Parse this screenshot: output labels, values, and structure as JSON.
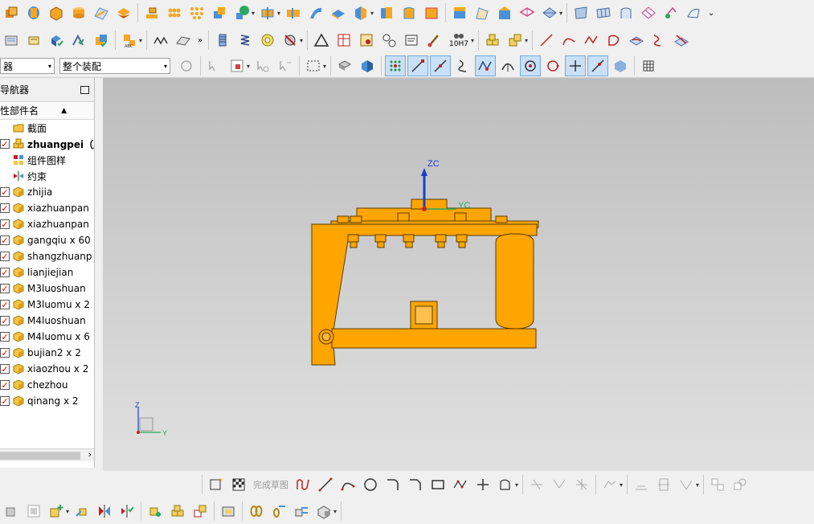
{
  "toolbar3": {
    "filter_combo": "器",
    "assembly_combo": "整个装配"
  },
  "navigator": {
    "title": "导航器",
    "column_header": "性部件名",
    "items": [
      {
        "label": "截面",
        "checked": false,
        "bold": false,
        "icon": "folder-icon"
      },
      {
        "label": "zhuangpei（顺序",
        "checked": true,
        "bold": true,
        "icon": "assembly-icon"
      },
      {
        "label": "组件图样",
        "checked": false,
        "bold": false,
        "icon": "component-pattern-icon"
      },
      {
        "label": "约束",
        "checked": false,
        "bold": false,
        "icon": "constraint-icon"
      },
      {
        "label": "zhijia",
        "checked": true,
        "bold": false,
        "icon": "part-icon"
      },
      {
        "label": "xiazhuanpan",
        "checked": true,
        "bold": false,
        "icon": "part-icon"
      },
      {
        "label": "xiazhuanpan",
        "checked": true,
        "bold": false,
        "icon": "part-icon"
      },
      {
        "label": "gangqiu x 60",
        "checked": true,
        "bold": false,
        "icon": "part-icon"
      },
      {
        "label": "shangzhuanp",
        "checked": true,
        "bold": false,
        "icon": "part-icon"
      },
      {
        "label": "lianjiejian",
        "checked": true,
        "bold": false,
        "icon": "part-icon"
      },
      {
        "label": "M3luoshuan",
        "checked": true,
        "bold": false,
        "icon": "part-icon"
      },
      {
        "label": "M3luomu x 2",
        "checked": true,
        "bold": false,
        "icon": "part-icon"
      },
      {
        "label": "M4luoshuan",
        "checked": true,
        "bold": false,
        "icon": "part-icon"
      },
      {
        "label": "M4luomu x 6",
        "checked": true,
        "bold": false,
        "icon": "part-icon"
      },
      {
        "label": "bujian2 x 2",
        "checked": true,
        "bold": false,
        "icon": "part-icon"
      },
      {
        "label": "xiaozhou x 2",
        "checked": true,
        "bold": false,
        "icon": "part-icon"
      },
      {
        "label": "chezhou",
        "checked": true,
        "bold": false,
        "icon": "part-icon"
      },
      {
        "label": "qinang x 2",
        "checked": true,
        "bold": false,
        "icon": "part-icon"
      }
    ]
  },
  "viewport": {
    "wcs_z": "ZC",
    "wcs_y": "YC",
    "triad_z": "Z",
    "triad_y": "Y"
  },
  "sketch_toolbar": {
    "finish_sketch": "完成草图"
  },
  "toolbar2": {
    "fit_label": "10H7"
  },
  "colors": {
    "model": "#ffa500",
    "model_edge": "#5a3a00",
    "viewport_top": "#bdbdbd",
    "viewport_bottom": "#e0e0e0"
  }
}
